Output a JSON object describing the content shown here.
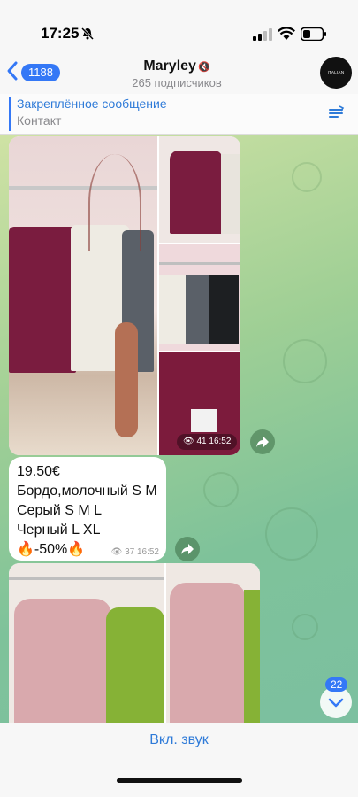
{
  "status_bar": {
    "time": "17:25"
  },
  "header": {
    "back_count": "1188",
    "channel_name": "Maryley",
    "mute_symbol": "🔇",
    "subscribers": "265 подписчиков",
    "avatar_text": "ITALIAN STYLE"
  },
  "pinned": {
    "title": "Закреплённое сообщение",
    "text": "Контакт"
  },
  "messages": {
    "album1": {
      "views": "41",
      "time": "16:52"
    },
    "post": {
      "lines": [
        "19.50€",
        "Бордо,молочный S M",
        "Серый S M L",
        "Черный L XL",
        "🔥-50%🔥"
      ],
      "views": "37",
      "time": "16:52"
    }
  },
  "scroll": {
    "unread_count": "22"
  },
  "bottom_bar": {
    "unmute_label": "Вкл. звук"
  },
  "colors": {
    "accent": "#3478f6",
    "link": "#2f7bd8",
    "burgundy": "#7a1c3f",
    "chat_green": "#9fcf95"
  }
}
